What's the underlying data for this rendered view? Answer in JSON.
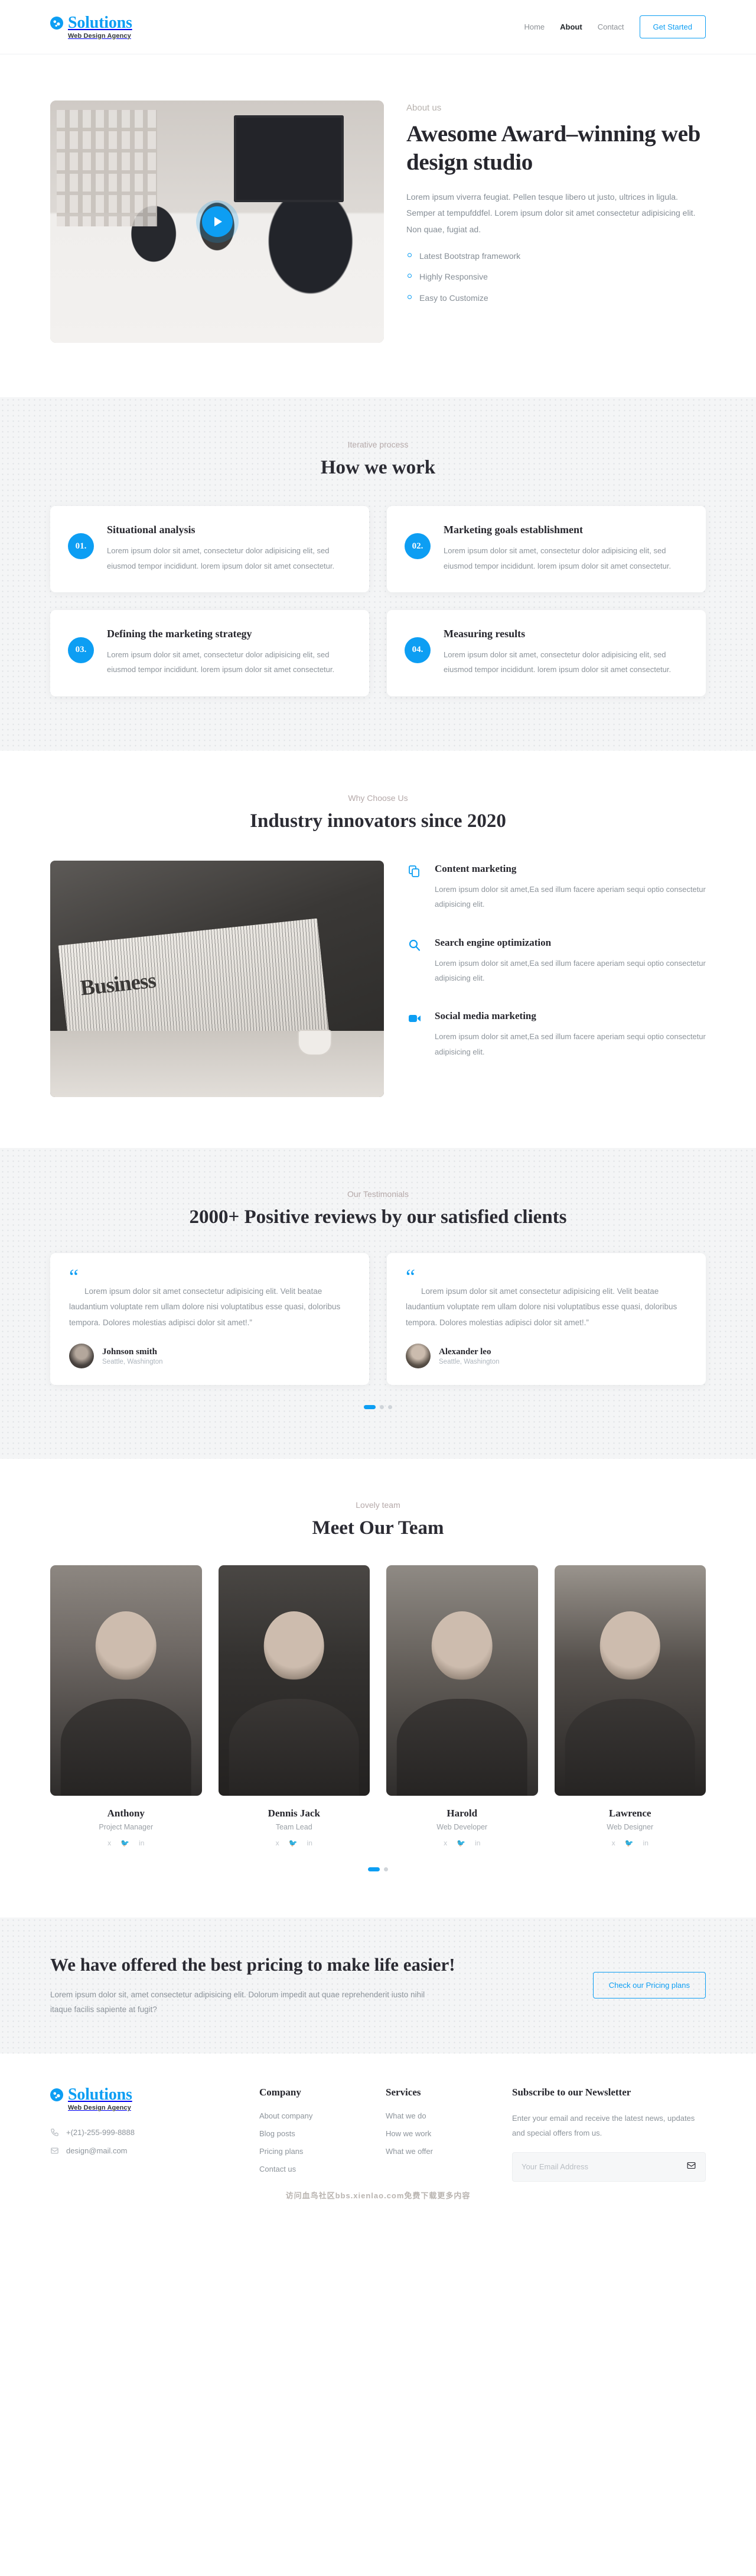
{
  "brand": {
    "name": "Solutions",
    "tagline": "Web Design Agency",
    "accent": "#0d9ef3",
    "icon": "globe-icon"
  },
  "nav": {
    "links": [
      {
        "label": "Home",
        "active": false
      },
      {
        "label": "About",
        "active": true
      },
      {
        "label": "Contact",
        "active": false
      }
    ],
    "cta_label": "Get Started"
  },
  "about": {
    "eyebrow": "About us",
    "title": "Awesome Award–winning web design studio",
    "paragraph": "Lorem ipsum viverra feugiat. Pellen tesque libero ut justo, ultrices in ligula. Semper at tempufddfel. Lorem ipsum dolor sit amet consectetur adipisicing elit. Non quae, fugiat ad.",
    "bullets": [
      "Latest Bootstrap framework",
      "Highly Responsive",
      "Easy to Customize"
    ],
    "play_icon": "play-icon"
  },
  "work": {
    "label": "Iterative process",
    "title": "How we work",
    "cards": [
      {
        "num": "01.",
        "title": "Situational analysis",
        "text": "Lorem ipsum dolor sit amet, consectetur dolor adipisicing elit, sed eiusmod tempor incididunt. lorem ipsum dolor sit amet consectetur."
      },
      {
        "num": "02.",
        "title": "Marketing goals establishment",
        "text": "Lorem ipsum dolor sit amet, consectetur dolor adipisicing elit, sed eiusmod tempor incididunt. lorem ipsum dolor sit amet consectetur."
      },
      {
        "num": "03.",
        "title": "Defining the marketing strategy",
        "text": "Lorem ipsum dolor sit amet, consectetur dolor adipisicing elit, sed eiusmod tempor incididunt. lorem ipsum dolor sit amet consectetur."
      },
      {
        "num": "04.",
        "title": "Measuring results",
        "text": "Lorem ipsum dolor sit amet, consectetur dolor adipisicing elit, sed eiusmod tempor incididunt. lorem ipsum dolor sit amet consectetur."
      }
    ]
  },
  "why": {
    "label": "Why Choose Us",
    "title": "Industry innovators since 2020",
    "features": [
      {
        "icon": "copy-files-icon",
        "title": "Content marketing",
        "text": "Lorem ipsum dolor sit amet,Ea sed illum facere aperiam sequi optio consectetur adipisicing elit."
      },
      {
        "icon": "search-icon",
        "title": "Search engine optimization",
        "text": "Lorem ipsum dolor sit amet,Ea sed illum facere aperiam sequi optio consectetur adipisicing elit."
      },
      {
        "icon": "video-camera-icon",
        "title": "Social media marketing",
        "text": "Lorem ipsum dolor sit amet,Ea sed illum facere aperiam sequi optio consectetur adipisicing elit."
      }
    ]
  },
  "testimonials": {
    "label": "Our Testimonials",
    "title": "2000+ Positive reviews by our satisfied clients",
    "items": [
      {
        "quote_icon": "quote-icon",
        "text": "Lorem ipsum dolor sit amet consectetur adipisicing elit. Velit beatae laudantium voluptate rem ullam dolore nisi voluptatibus esse quasi, doloribus tempora. Dolores molestias adipisci dolor sit amet!.”",
        "name": "Johnson smith",
        "location": "Seattle, Washington"
      },
      {
        "quote_icon": "quote-icon",
        "text": "Lorem ipsum dolor sit amet consectetur adipisicing elit. Velit beatae laudantium voluptate rem ullam dolore nisi voluptatibus esse quasi, doloribus tempora. Dolores molestias adipisci dolor sit amet!.”",
        "name": "Alexander leo",
        "location": "Seattle, Washington"
      }
    ],
    "dots": [
      true,
      false,
      false
    ]
  },
  "team": {
    "label": "Lovely team",
    "title": "Meet Our Team",
    "members": [
      {
        "name": "Anthony",
        "role": "Project Manager"
      },
      {
        "name": "Dennis Jack",
        "role": "Team Lead"
      },
      {
        "name": "Harold",
        "role": "Web Developer"
      },
      {
        "name": "Lawrence",
        "role": "Web Designer"
      }
    ],
    "social_icons": [
      "facebook-icon",
      "twitter-icon",
      "linkedin-icon"
    ],
    "dots": [
      true,
      false
    ]
  },
  "cta": {
    "title": "We have offered the best pricing to make life easier!",
    "text": "Lorem ipsum dolor sit, amet consectetur adipisicing elit. Dolorum impedit aut quae reprehenderit iusto nihil itaque facilis sapiente at fugit?",
    "button_label": "Check our Pricing plans"
  },
  "footer": {
    "phone": "+(21)-255-999-8888",
    "email": "design@mail.com",
    "phone_icon": "phone-icon",
    "email_icon": "envelope-icon",
    "company": {
      "heading": "Company",
      "links": [
        "About company",
        "Blog posts",
        "Pricing plans",
        "Contact us"
      ]
    },
    "services": {
      "heading": "Services",
      "links": [
        "What we do",
        "How we work",
        "What we offer"
      ]
    },
    "newsletter": {
      "heading": "Subscribe to our Newsletter",
      "text": "Enter your email and receive the latest news, updates and special offers from us.",
      "placeholder": "Your Email Address",
      "submit_icon": "envelope-icon"
    },
    "watermark": "访问血鸟社区bbs.xienlao.com免费下载更多内容"
  }
}
